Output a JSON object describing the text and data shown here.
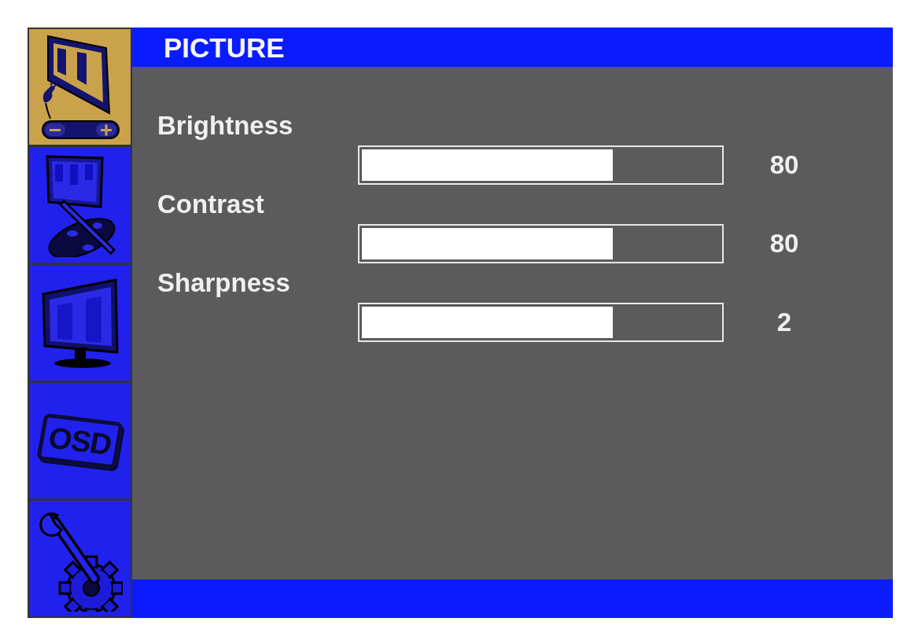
{
  "sidebar": {
    "items": [
      {
        "kind": "picture",
        "selected": true
      },
      {
        "kind": "color",
        "selected": false
      },
      {
        "kind": "display",
        "selected": false
      },
      {
        "kind": "osd",
        "label": "OSD",
        "selected": false
      },
      {
        "kind": "setup",
        "selected": false
      }
    ]
  },
  "header": {
    "title": "PICTURE"
  },
  "settings": [
    {
      "label": "Brightness",
      "level": 0.7,
      "reading": "80"
    },
    {
      "label": "Contrast",
      "level": 0.7,
      "reading": "80"
    },
    {
      "label": "Sharpness",
      "level": 0.7,
      "reading": "2"
    }
  ]
}
